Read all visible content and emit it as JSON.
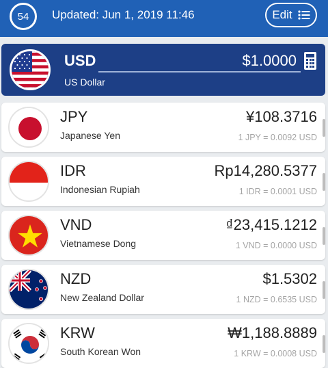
{
  "header": {
    "refresh_count": "54",
    "updated_text": "Updated: Jun 1, 2019 11:46",
    "edit_label": "Edit",
    "color": "#2061b6"
  },
  "base": {
    "code": "USD",
    "name": "US Dollar",
    "amount": "$1.0000",
    "flag_icon": "us-flag-icon",
    "color": "#1d3f86"
  },
  "currencies": [
    {
      "code": "JPY",
      "name": "Japanese Yen",
      "value": "¥108.3716",
      "rate": "1 JPY = 0.0092 USD",
      "flag_icon": "japan-flag-icon"
    },
    {
      "code": "IDR",
      "name": "Indonesian Rupiah",
      "value": "Rp14,280.5377",
      "rate": "1 IDR = 0.0001 USD",
      "flag_icon": "indonesia-flag-icon"
    },
    {
      "code": "VND",
      "name": "Vietnamese Dong",
      "value": "₫23,415.1212",
      "rate": "1 VND = 0.0000 USD",
      "flag_icon": "vietnam-flag-icon"
    },
    {
      "code": "NZD",
      "name": "New Zealand Dollar",
      "value": "$1.5302",
      "rate": "1 NZD = 0.6535 USD",
      "flag_icon": "new-zealand-flag-icon"
    },
    {
      "code": "KRW",
      "name": "South Korean Won",
      "value": "₩1,188.8889",
      "rate": "1 KRW = 0.0008 USD",
      "flag_icon": "south-korea-flag-icon"
    }
  ]
}
